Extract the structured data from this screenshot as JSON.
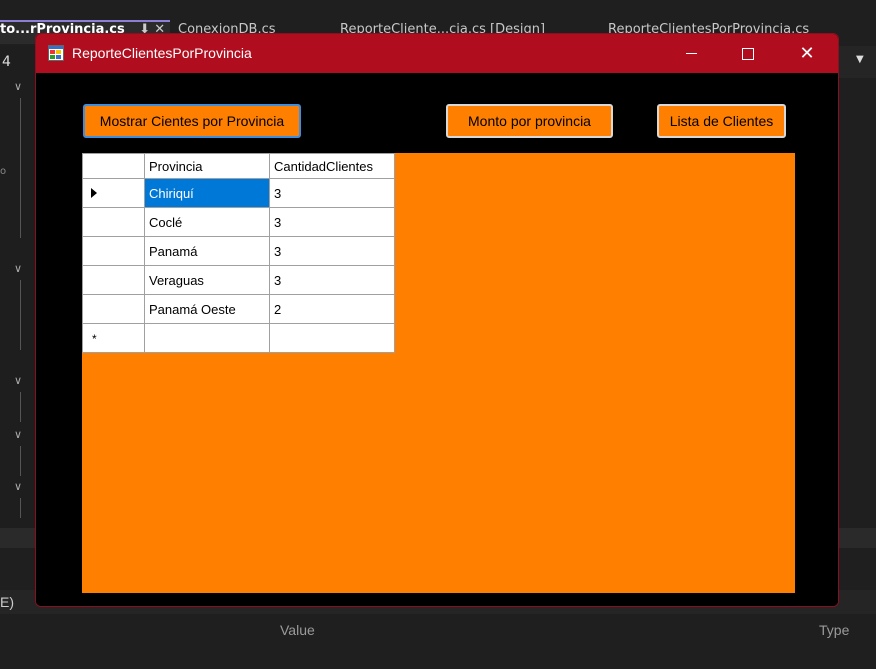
{
  "ide": {
    "tabs": [
      "to...rProvincia.cs",
      "ConexionDB.cs",
      "ReporteCliente...cia.cs [Design]",
      "ReporteClientesPorProvincia.cs"
    ],
    "tab_icons": "⬇ ✕",
    "side_number": "4",
    "side_glyph": "o",
    "bottom_left_text": "E)",
    "col_value": "Value",
    "col_type": "Type"
  },
  "window": {
    "title": "ReporteClientesPorProvincia",
    "app_icon": "winforms-form-icon",
    "colors": {
      "titlebar": "#b00d1e",
      "form_bg": "#000000",
      "accent_orange": "#ff7f00",
      "selection": "#0078d7"
    }
  },
  "buttons": {
    "mostrar": "Mostrar Cientes por Provincia",
    "monto": "Monto por provincia",
    "lista": "Lista de Clientes"
  },
  "table": {
    "headers": [
      "Provincia",
      "CantidadClientes"
    ],
    "rows": [
      [
        "Chiriquí",
        "3"
      ],
      [
        "Coclé",
        "3"
      ],
      [
        "Panamá",
        "3"
      ],
      [
        "Veraguas",
        "3"
      ],
      [
        "Panamá Oeste",
        "2"
      ]
    ],
    "new_row_marker": "*",
    "selected_row": 0
  }
}
